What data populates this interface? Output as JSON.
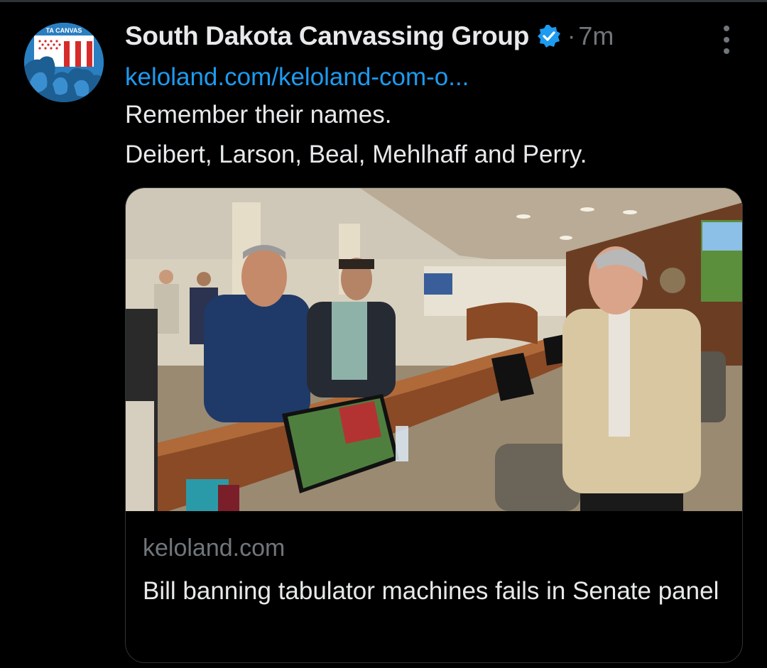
{
  "post": {
    "author_name": "South Dakota Canvassing Group",
    "separator": "·",
    "timestamp": "7m",
    "link": "keloland.com/keloland-com-o...",
    "text_lines": [
      "Remember their names.",
      "Deibert, Larson, Beal, Mehlhaff and Perry."
    ]
  },
  "avatar": {
    "logo_text": "TA CANVAS",
    "icon": "mount-rushmore-flag-logo"
  },
  "icons": {
    "verified": "verified-badge-icon",
    "more": "more-vertical-icon"
  },
  "card": {
    "domain": "keloland.com",
    "title": "Bill banning tabulator machines fails in Senate panel",
    "image": "legislative-committee-room-photo"
  },
  "colors": {
    "background": "#000000",
    "text_primary": "#e7e9ea",
    "text_secondary": "#71767b",
    "link": "#1d9bf0",
    "border": "#2f3336"
  }
}
